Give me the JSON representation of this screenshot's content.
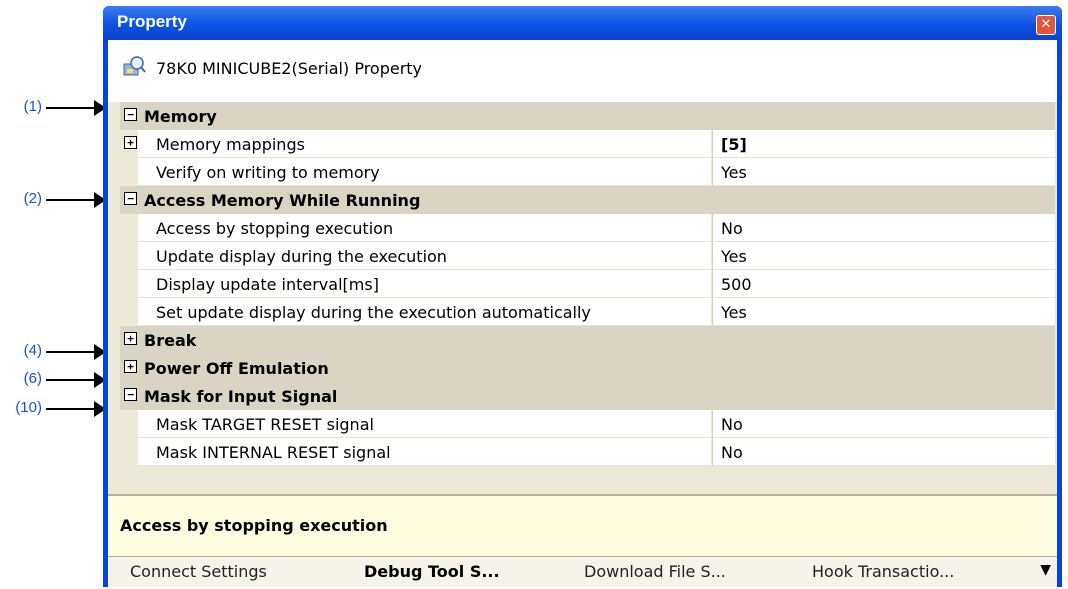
{
  "callouts": [
    "(1)",
    "(2)",
    "(4)",
    "(6)",
    "(10)"
  ],
  "window": {
    "title": "Property",
    "close_glyph": "✕"
  },
  "header": {
    "icon": "property-gear-icon",
    "text": "78K0 MINICUBE2(Serial) Property"
  },
  "categories": {
    "memory": "Memory",
    "access_memory": "Access Memory While Running",
    "break": "Break",
    "power_off": "Power Off Emulation",
    "mask_input": "Mask for Input Signal"
  },
  "items": {
    "memory_mappings": {
      "name": "Memory mappings",
      "value": "[5]"
    },
    "verify_writing": {
      "name": "Verify on writing to memory",
      "value": "Yes"
    },
    "access_stopping": {
      "name": "Access by stopping execution",
      "value": "No"
    },
    "update_display": {
      "name": "Update display during the execution",
      "value": "Yes"
    },
    "update_interval": {
      "name": "Display update interval[ms]",
      "value": "500"
    },
    "set_update_auto": {
      "name": "Set update display during the execution automatically",
      "value": "Yes"
    },
    "mask_target_reset": {
      "name": "Mask TARGET RESET signal",
      "value": "No"
    },
    "mask_internal_reset": {
      "name": "Mask INTERNAL RESET signal",
      "value": "No"
    }
  },
  "description": "Access by stopping execution",
  "tabs": [
    "Connect Settings",
    "Debug Tool S...",
    "Download File S...",
    "Hook Transactio..."
  ],
  "tab_menu_glyph": "▼",
  "expand_glyph": "+",
  "collapse_glyph": "−"
}
